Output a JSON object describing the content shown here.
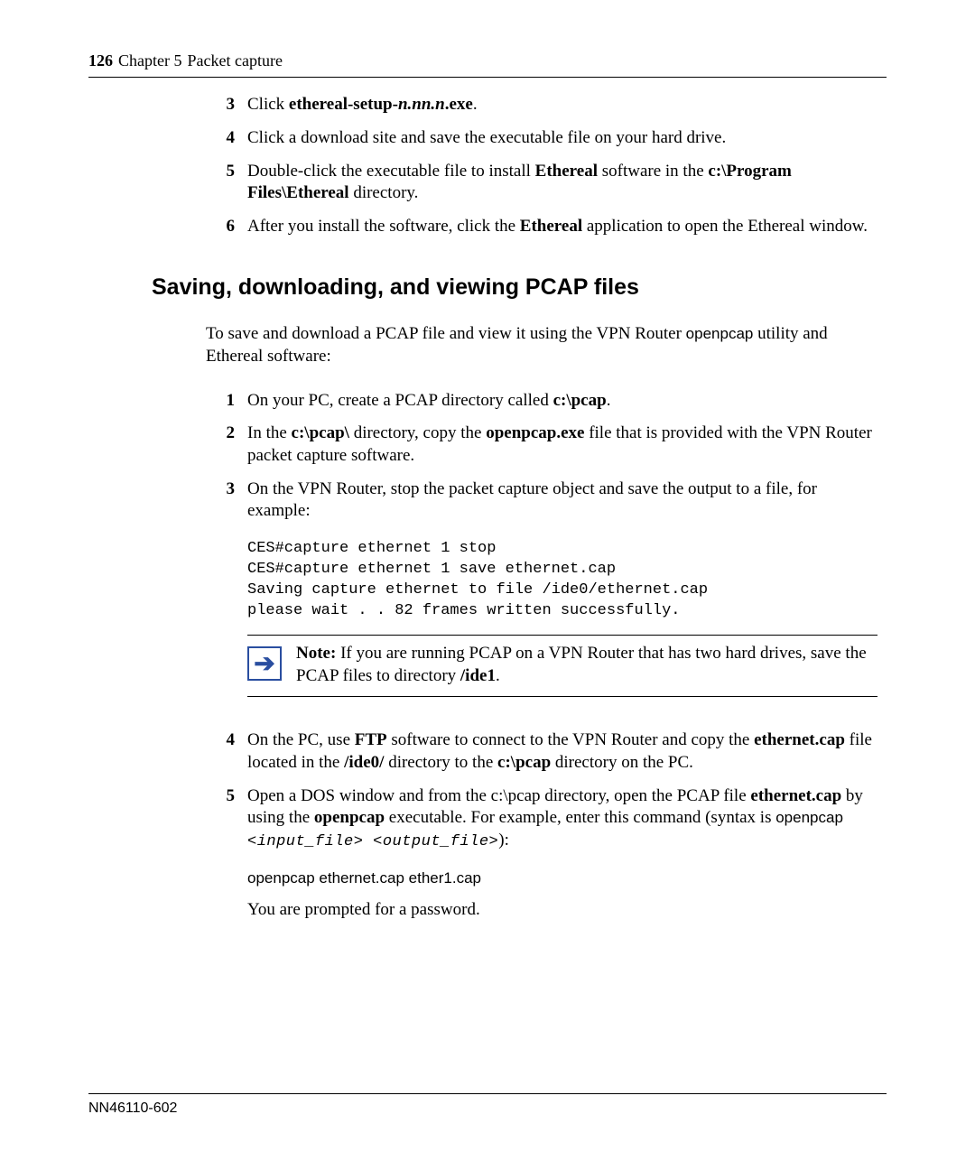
{
  "header": {
    "page_number": "126",
    "chapter": "Chapter 5",
    "title": "Packet capture"
  },
  "steps_top": {
    "s3": {
      "num": "3",
      "lead": "Click ",
      "bold1": "ethereal-setup-",
      "bolditalic": "n.nn.n",
      "bold2": ".exe",
      "trail": "."
    },
    "s4": {
      "num": "4",
      "text": "Click a download site and save the executable file on your hard drive."
    },
    "s5": {
      "num": "5",
      "pre": "Double-click the executable file to install ",
      "b1": "Ethereal",
      "mid": " software in the ",
      "b2": "c:\\Program Files\\Ethereal",
      "post": " directory."
    },
    "s6": {
      "num": "6",
      "pre": "After you install the software, click the ",
      "b1": "Ethereal",
      "post": " application to open the Ethereal window."
    }
  },
  "section_heading": "Saving, downloading, and viewing PCAP files",
  "intro": {
    "pre": "To save and download a PCAP file and view it using the VPN Router ",
    "code": "openpcap",
    "post": " utility and Ethereal software:"
  },
  "steps_bottom": {
    "s1": {
      "num": "1",
      "pre": "On your PC, create a PCAP directory called ",
      "b1": "c:\\pcap",
      "post": "."
    },
    "s2": {
      "num": "2",
      "pre": "In the ",
      "b1": "c:\\pcap\\",
      "mid1": " directory, copy the ",
      "b2": "openpcap.exe",
      "post": " file that is provided with the VPN Router packet capture software."
    },
    "s3": {
      "num": "3",
      "text": "On the VPN Router, stop the packet capture object and save the output to a file, for example:",
      "code": "CES#capture ethernet 1 stop\nCES#capture ethernet 1 save ethernet.cap\nSaving capture ethernet to file /ide0/ethernet.cap\nplease wait . . 82 frames written successfully."
    },
    "note": {
      "label": "Note:",
      "pre": " If you are running PCAP on a VPN Router that has two hard drives, save the PCAP files to directory ",
      "b1": "/ide1",
      "post": "."
    },
    "s4": {
      "num": "4",
      "pre": "On the PC, use ",
      "b1": "FTP",
      "mid1": " software to connect to the VPN Router and copy the ",
      "b2": "ethernet.cap",
      "mid2": " file located in the ",
      "b3": "/ide0/",
      "mid3": " directory to the ",
      "b4": "c:\\pcap",
      "post": " directory on the PC."
    },
    "s5": {
      "num": "5",
      "pre": "Open a DOS window and from the c:\\pcap directory, open the PCAP file ",
      "b1": "ethernet.cap",
      "mid1": " by using the ",
      "b2": "openpcap",
      "mid2": " executable. For example, enter this command (syntax is ",
      "code1": "openpcap ",
      "italic1": "<input_file> <output_file>",
      "post1": "):",
      "cmd": "openpcap ethernet.cap ether1.cap",
      "tail": "You are prompted for a password."
    }
  },
  "footer": "NN46110-602"
}
